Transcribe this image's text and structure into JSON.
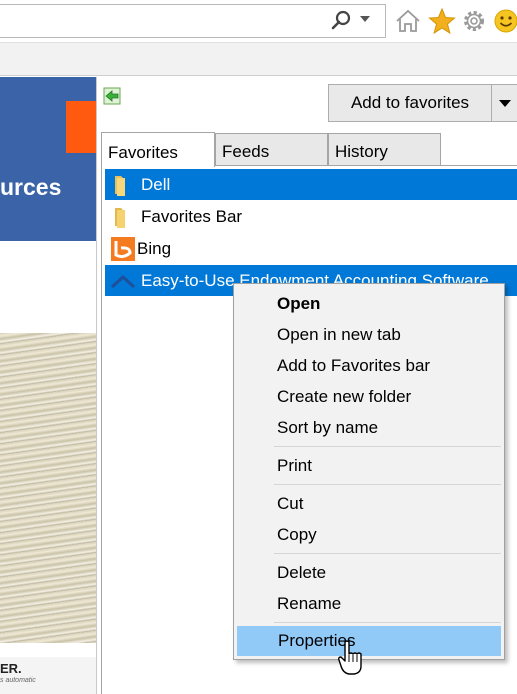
{
  "browser": {
    "search_icon": "search-icon",
    "toolbar_icons": [
      "home-icon",
      "star-icon",
      "gear-icon",
      "smiley-icon"
    ],
    "accent": "#0078d7"
  },
  "webpage": {
    "banner_text": "urces",
    "footer_logo": "ER.",
    "footer_sub": "s automatic"
  },
  "favorites_pane": {
    "add_button_label": "Add to favorites",
    "tabs": [
      {
        "label": "Favorites"
      },
      {
        "label": "Feeds"
      },
      {
        "label": "History"
      }
    ],
    "items": [
      {
        "label": "Dell",
        "icon": "folder-icon",
        "selected": true
      },
      {
        "label": "Favorites Bar",
        "icon": "folder-icon",
        "selected": false
      },
      {
        "label": "Bing",
        "icon": "bing-icon",
        "selected": false
      },
      {
        "label": "Easy-to-Use Endowment Accounting Software...",
        "icon": "site-icon",
        "selected": true
      }
    ]
  },
  "context_menu": {
    "items": [
      {
        "label": "Open"
      },
      {
        "label": "Open in new tab"
      },
      {
        "label": "Add to Favorites bar"
      },
      {
        "label": "Create new folder"
      },
      {
        "label": "Sort by name"
      },
      {
        "label": "Print"
      },
      {
        "label": "Cut"
      },
      {
        "label": "Copy"
      },
      {
        "label": "Delete"
      },
      {
        "label": "Rename"
      },
      {
        "label": "Properties"
      }
    ],
    "hover_color": "#91c9f7"
  }
}
